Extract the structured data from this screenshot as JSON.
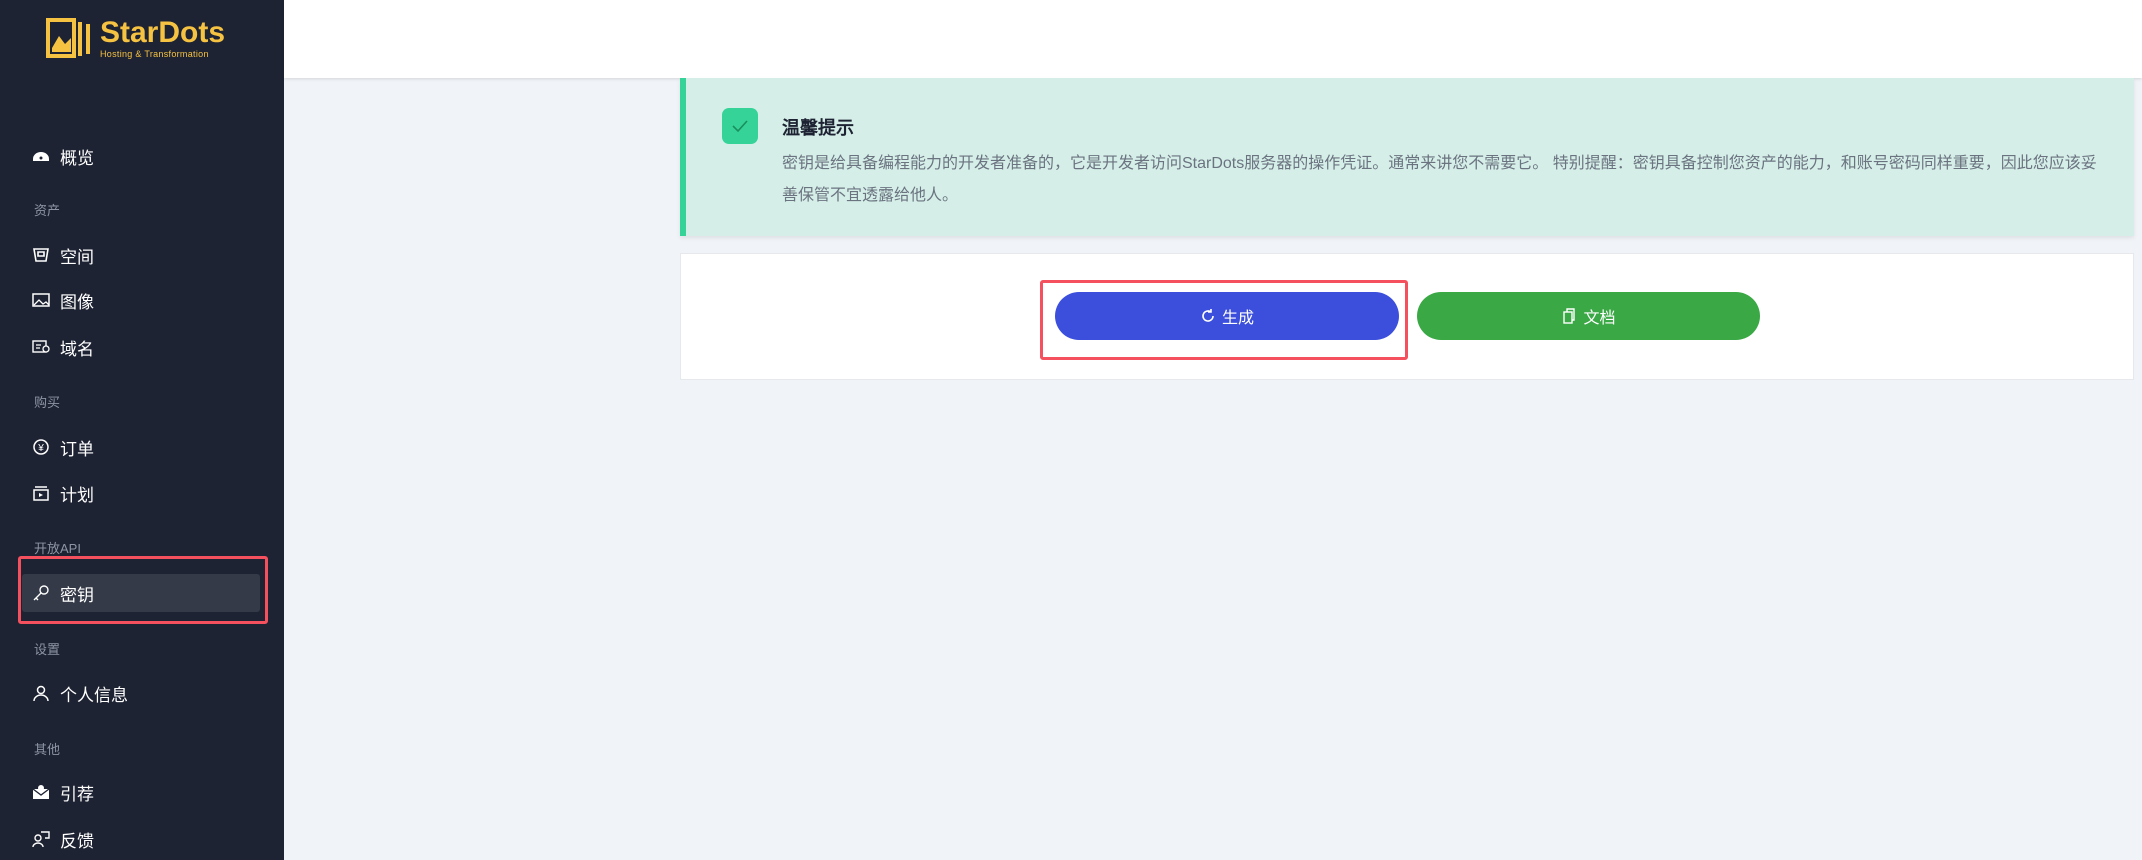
{
  "brand": {
    "name": "StarDots",
    "tagline": "Hosting & Transformation"
  },
  "sidebar": {
    "overview": "概览",
    "groups": {
      "assets": "资产",
      "purchase": "购买",
      "open_api": "开放API",
      "settings": "设置",
      "other": "其他"
    },
    "items": {
      "space": "空间",
      "images": "图像",
      "domains": "域名",
      "orders": "订单",
      "plans": "计划",
      "keys": "密钥",
      "profile": "个人信息",
      "referral": "引荐",
      "feedback": "反馈"
    },
    "active": "keys"
  },
  "alert": {
    "title": "温馨提示",
    "text": "密钥是给具备编程能力的开发者准备的，它是开发者访问StarDots服务器的操作凭证。通常来讲您不需要它。 特别提醒：密钥具备控制您资产的能力，和账号密码同样重要，因此您应该妥善保管不宜透露给他人。"
  },
  "actions": {
    "generate": "生成",
    "docs": "文档"
  },
  "colors": {
    "sidebar": "#1e2333",
    "brand": "#f5c242",
    "generate": "#3b4fdc",
    "docs": "#3aa845",
    "alert": "#d5efe8",
    "highlight": "#f4505e"
  }
}
